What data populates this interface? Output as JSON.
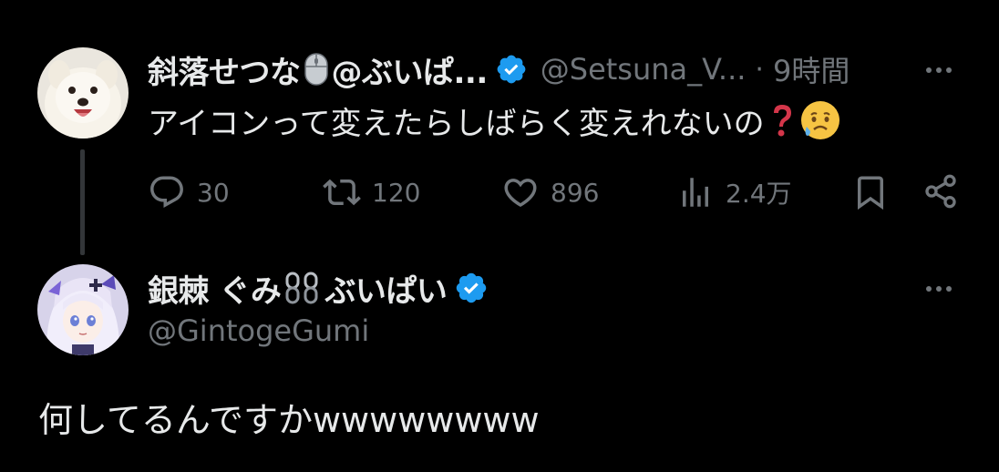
{
  "colors": {
    "background": "#000000",
    "text_primary": "#e7e9ea",
    "text_secondary": "#71767b",
    "verified_blue": "#1d9bf0",
    "thread_line": "#333639"
  },
  "post": {
    "author_name": "斜落せつな",
    "author_name_suffix": "@ぶいぱ...",
    "author_handle": "@Setsuna_V...",
    "separator": "·",
    "time": "9時間",
    "name_emoji": "mouse-icon",
    "text": "アイコンって変えたらしばらく変えれないの",
    "text_emojis": [
      "question-mark-icon",
      "sad-relieved-face-icon"
    ],
    "stats": {
      "replies": "30",
      "reposts": "120",
      "likes": "896",
      "views": "2.4万"
    }
  },
  "reply": {
    "author_name": "銀棘 ぐみ",
    "author_name_suffix": "ぶいぱい",
    "name_emoji": "chain-icon",
    "author_handle": "@GintogeGumi",
    "text": "何してるんですかwwwwwwww"
  }
}
